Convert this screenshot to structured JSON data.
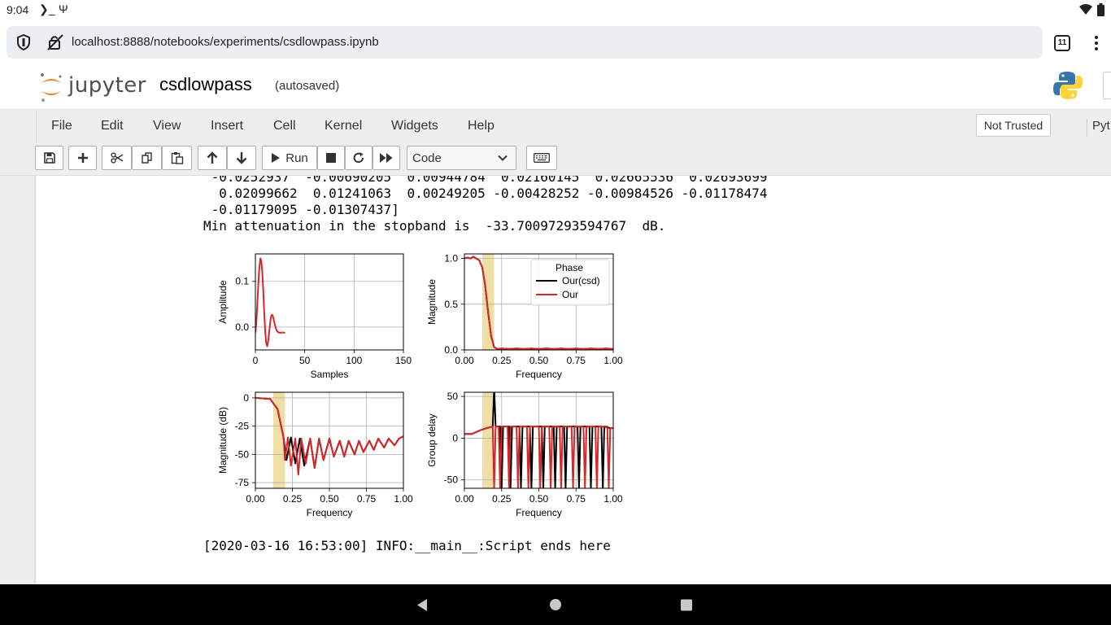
{
  "status_bar": {
    "time": "9:04",
    "terminal_icon": "terminal-icon",
    "usb_icon": "usb-icon",
    "wifi_icon": "wifi-icon",
    "battery_icon": "battery-icon"
  },
  "browser": {
    "url": "localhost:8888/notebooks/experiments/csdlowpass.ipynb",
    "tab_count": "11"
  },
  "header": {
    "logo_text": "jupyter",
    "notebook_name": "csdlowpass",
    "autosave_status": "(autosaved)"
  },
  "menu": {
    "items": [
      "File",
      "Edit",
      "View",
      "Insert",
      "Cell",
      "Kernel",
      "Widgets",
      "Help"
    ],
    "trust_label": "Not Trusted",
    "kernel_label": "Pyt"
  },
  "toolbar": {
    "run_label": "Run",
    "cell_type": "Code"
  },
  "output": {
    "line0": " -0.0252937  -0.00690205  0.00944784  0.02160145  0.02665536  0.02693699",
    "line1": "  0.02099662  0.01241063  0.00249205 -0.00428252 -0.00984526 -0.01178474",
    "line2": " -0.01179095 -0.01307437]",
    "line3": "Min attenuation in the stopband is  -33.70097293594767  dB.",
    "log_line": "[2020-03-16 16:53:00] INFO:__main__:Script ends here"
  },
  "chart_data": [
    {
      "type": "line",
      "xlabel": "Samples",
      "ylabel": "Amplitude",
      "xticks": [
        "0",
        "50",
        "100",
        "150"
      ],
      "yticks": [
        "0.0",
        "0.1"
      ],
      "xlim": [
        0,
        150
      ],
      "ylim": [
        -0.05,
        0.16
      ],
      "series": [
        {
          "color": "#d62728",
          "x": [
            0,
            1,
            2,
            3,
            4,
            5,
            6,
            7,
            8,
            9,
            10,
            11,
            12,
            13,
            14,
            15,
            16,
            17,
            18,
            19,
            20,
            21,
            22,
            23,
            24,
            25,
            26,
            27,
            28,
            29,
            30
          ],
          "values": [
            -0.013,
            0.01,
            0.05,
            0.095,
            0.13,
            0.15,
            0.145,
            0.12,
            0.08,
            0.03,
            -0.01,
            -0.035,
            -0.042,
            -0.03,
            -0.01,
            0.01,
            0.024,
            0.027,
            0.022,
            0.012,
            0.003,
            -0.004,
            -0.009,
            -0.011,
            -0.012,
            -0.013,
            -0.012,
            -0.012,
            -0.012,
            -0.012,
            -0.013
          ]
        }
      ],
      "grid": true
    },
    {
      "type": "line",
      "xlabel": "Frequency",
      "ylabel": "Magnitude",
      "xticks": [
        "0.00",
        "0.25",
        "0.50",
        "0.75",
        "1.00"
      ],
      "yticks": [
        "0.0",
        "0.5",
        "1.0"
      ],
      "xlim": [
        0,
        1
      ],
      "ylim": [
        0,
        1.05
      ],
      "band": [
        0.12,
        0.2
      ],
      "legend": {
        "title": "Phase",
        "entries": [
          "Our(csd)",
          "Our"
        ],
        "position": "top-right"
      },
      "series": [
        {
          "name": "Our(csd)",
          "color": "#000000",
          "x": [
            0,
            0.02,
            0.04,
            0.06,
            0.08,
            0.1,
            0.12,
            0.14,
            0.16,
            0.18,
            0.2,
            0.22,
            0.25,
            0.3,
            0.35,
            0.4,
            0.45,
            0.5,
            0.55,
            0.6,
            0.65,
            0.7,
            0.75,
            0.8,
            0.85,
            0.9,
            0.95,
            1.0
          ],
          "values": [
            1.0,
            1.01,
            1.0,
            1.02,
            1.0,
            0.98,
            0.9,
            0.7,
            0.4,
            0.15,
            0.03,
            0.01,
            0.015,
            0.01,
            0.015,
            0.01,
            0.015,
            0.01,
            0.015,
            0.01,
            0.015,
            0.01,
            0.015,
            0.01,
            0.015,
            0.01,
            0.015,
            0.01
          ]
        },
        {
          "name": "Our",
          "color": "#d62728",
          "x": [
            0,
            0.02,
            0.04,
            0.06,
            0.08,
            0.1,
            0.12,
            0.14,
            0.16,
            0.18,
            0.2,
            0.22,
            0.25,
            0.3,
            0.35,
            0.4,
            0.45,
            0.5,
            0.55,
            0.6,
            0.65,
            0.7,
            0.75,
            0.8,
            0.85,
            0.9,
            0.95,
            1.0
          ],
          "values": [
            1.0,
            1.01,
            1.0,
            1.02,
            1.0,
            0.98,
            0.9,
            0.7,
            0.4,
            0.15,
            0.03,
            0.01,
            0.015,
            0.01,
            0.015,
            0.01,
            0.015,
            0.01,
            0.015,
            0.01,
            0.015,
            0.01,
            0.015,
            0.01,
            0.015,
            0.01,
            0.015,
            0.01
          ]
        }
      ],
      "grid": true
    },
    {
      "type": "line",
      "xlabel": "Frequency",
      "ylabel": "Magnitude (dB)",
      "xticks": [
        "0.00",
        "0.25",
        "0.50",
        "0.75",
        "1.00"
      ],
      "yticks": [
        "0",
        "-25",
        "-50",
        "-75"
      ],
      "xlim": [
        0,
        1
      ],
      "ylim": [
        -80,
        5
      ],
      "band": [
        0.12,
        0.2
      ],
      "series": [
        {
          "name": "Our(csd)",
          "color": "#000000",
          "x": [
            0,
            0.1,
            0.15,
            0.19,
            0.21,
            0.24,
            0.27,
            0.3,
            0.33,
            0.37,
            0.4,
            0.43,
            0.46,
            0.5,
            0.53,
            0.57,
            0.6,
            0.63,
            0.67,
            0.7,
            0.73,
            0.77,
            0.8,
            0.83,
            0.87,
            0.9,
            0.94,
            0.97,
            1.0
          ],
          "values": [
            0,
            -1,
            -10,
            -35,
            -55,
            -35,
            -58,
            -36,
            -60,
            -36,
            -62,
            -36,
            -55,
            -36,
            -52,
            -38,
            -52,
            -38,
            -50,
            -38,
            -48,
            -38,
            -46,
            -36,
            -44,
            -36,
            -42,
            -36,
            -34
          ]
        },
        {
          "name": "Our",
          "color": "#d62728",
          "x": [
            0,
            0.1,
            0.15,
            0.19,
            0.2,
            0.22,
            0.24,
            0.27,
            0.29,
            0.31,
            0.34,
            0.37,
            0.4,
            0.43,
            0.46,
            0.5,
            0.53,
            0.57,
            0.6,
            0.63,
            0.67,
            0.7,
            0.73,
            0.77,
            0.8,
            0.83,
            0.87,
            0.9,
            0.94,
            0.97,
            1.0
          ],
          "values": [
            0,
            -1,
            -10,
            -35,
            -55,
            -35,
            -60,
            -36,
            -68,
            -36,
            -58,
            -36,
            -62,
            -36,
            -55,
            -36,
            -52,
            -38,
            -52,
            -38,
            -50,
            -38,
            -48,
            -38,
            -46,
            -36,
            -44,
            -36,
            -42,
            -36,
            -34
          ]
        }
      ],
      "grid": true
    },
    {
      "type": "line",
      "xlabel": "Frequency",
      "ylabel": "Group delay",
      "xticks": [
        "0.00",
        "0.25",
        "0.50",
        "0.75",
        "1.00"
      ],
      "yticks": [
        "50",
        "0",
        "-50"
      ],
      "xlim": [
        0,
        1
      ],
      "ylim": [
        -60,
        55
      ],
      "band": [
        0.12,
        0.2
      ],
      "series": [
        {
          "name": "Our(csd)",
          "color": "#000000",
          "x": [
            0,
            0.05,
            0.1,
            0.15,
            0.19,
            0.2,
            0.21,
            0.24,
            0.25,
            0.26,
            0.3,
            0.31,
            0.32,
            0.37,
            0.38,
            0.39,
            0.44,
            0.45,
            0.46,
            0.52,
            0.53,
            0.54,
            0.6,
            0.61,
            0.62,
            0.67,
            0.68,
            0.69,
            0.76,
            0.77,
            0.78,
            0.84,
            0.85,
            0.86,
            0.92,
            0.93,
            0.94,
            0.98,
            1.0
          ],
          "values": [
            5,
            5,
            9,
            12,
            14,
            60,
            14,
            14,
            -60,
            14,
            14,
            -60,
            14,
            14,
            -60,
            14,
            14,
            -60,
            14,
            14,
            -60,
            14,
            14,
            -60,
            14,
            14,
            -60,
            14,
            14,
            -60,
            14,
            14,
            -60,
            14,
            14,
            -60,
            14,
            12,
            12
          ]
        },
        {
          "name": "Our",
          "color": "#d62728",
          "x": [
            0,
            0.05,
            0.1,
            0.15,
            0.19,
            0.2,
            0.21,
            0.23,
            0.24,
            0.25,
            0.29,
            0.3,
            0.31,
            0.35,
            0.36,
            0.37,
            0.42,
            0.43,
            0.44,
            0.5,
            0.51,
            0.52,
            0.57,
            0.58,
            0.59,
            0.64,
            0.65,
            0.66,
            0.72,
            0.73,
            0.74,
            0.8,
            0.81,
            0.82,
            0.88,
            0.89,
            0.9,
            0.96,
            0.97,
            0.98,
            1.0
          ],
          "values": [
            5,
            5,
            9,
            12,
            14,
            -60,
            14,
            14,
            -60,
            14,
            14,
            -60,
            14,
            14,
            -60,
            14,
            14,
            -60,
            14,
            14,
            -60,
            14,
            14,
            -60,
            14,
            14,
            -60,
            14,
            14,
            -60,
            14,
            14,
            -60,
            14,
            14,
            -60,
            14,
            14,
            -60,
            12,
            12
          ]
        }
      ],
      "grid": true
    }
  ]
}
